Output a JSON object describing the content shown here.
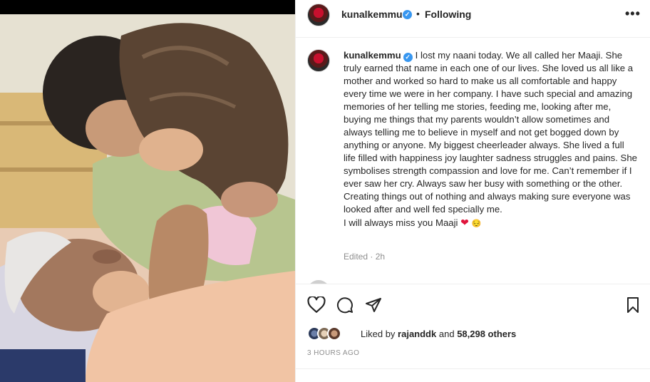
{
  "post": {
    "username": "kunalkemmu",
    "verified_icon": "verified-badge-icon",
    "separator": "•",
    "follow_status": "Following",
    "more_icon": "more-options-icon"
  },
  "caption": {
    "username": "kunalkemmu",
    "text": "I lost my naani today. We all called her Maaji. She truly earned that name in each one of our lives. She loved us all like a mother and worked so hard to make us all comfortable and happy every time we were in her company. I have such special and amazing memories of her telling me stories, feeding me, looking after me, buying me things that my parents wouldn’t allow sometimes and always telling me to believe in myself and not get bogged down by anything or anyone. My biggest cheerleader always. She lived a full life filled with happiness joy laughter sadness struggles and pains. She symbolises strength compassion and love for me. Can’t remember if I ever saw her cry. Always saw her busy with something or the other. Creating things out of nothing and always making sure everyone was looked after and well fed specially me.",
    "last_line": "I will always miss you Maaji",
    "emoji_heart": "❤",
    "emoji_face": "😔",
    "edited": "Edited · 2h"
  },
  "actions": {
    "like_icon": "heart-icon",
    "comment_icon": "comment-icon",
    "share_icon": "share-icon",
    "save_icon": "bookmark-icon"
  },
  "likes": {
    "prefix": "Liked by",
    "user": "rajanddk",
    "conj": "and",
    "count": "58,298 others"
  },
  "timestamp": "3 HOURS AGO",
  "colors": {
    "text": "#262626",
    "muted": "#8e8e8e",
    "verified": "#3897f0",
    "heart": "#e0143c",
    "divider": "#efefef"
  }
}
